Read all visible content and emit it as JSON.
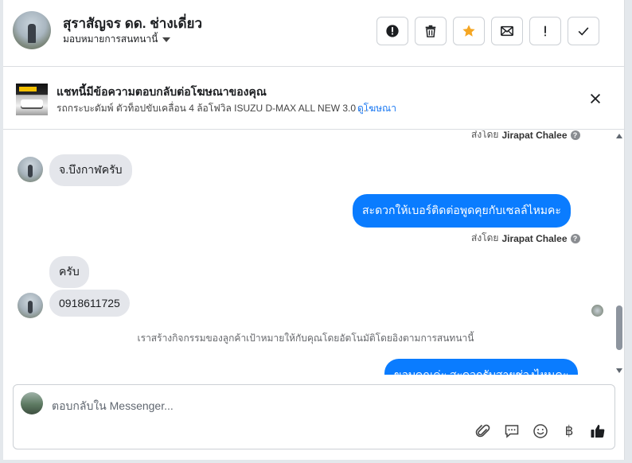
{
  "header": {
    "contact_name": "สุราสัญจร ดด. ช่างเดี่ยว",
    "assign_label": "มอบหมายการสนทนานี้",
    "actions": [
      "spam-icon",
      "trash-icon",
      "star-icon",
      "mail-icon",
      "exclamation-icon",
      "check-icon"
    ],
    "star_color": "#f5a623"
  },
  "ad": {
    "title": "แชทนี้มีข้อความตอบกลับต่อโฆษณาของคุณ",
    "description": "รถกระบะดัมพ์ ตัวท็อปขับเคลื่อน 4 ล้อโฟวิล ISUZU D-MAX ALL NEW 3.0 ...",
    "link": "ดูโฆษณา"
  },
  "chat": {
    "sent_by_prefix": "ส่งโดย",
    "sender_name": "Jirapat Chalee",
    "messages": [
      {
        "from": "customer",
        "text": "จ.บึงกาฬครับ"
      },
      {
        "from": "page",
        "text": "สะดวกให้เบอร์ติดต่อพูดคุยกับเซลล์ไหมคะ"
      },
      {
        "from": "customer",
        "text": "ครับ"
      },
      {
        "from": "customer",
        "text": "0918611725"
      },
      {
        "from": "page",
        "text": "ขอบคุณค่ะ สะดวกรับสายช่วงไหนคะ"
      }
    ],
    "system_note": "เราสร้างกิจกรรมของลูกค้าเป้าหมายให้กับคุณโดยอัตโนมัติโดยอิงตามการสนทนานี้",
    "outgoing_color": "#0a7cff"
  },
  "composer": {
    "placeholder": "ตอบกลับใน Messenger...",
    "icons": [
      "attachment-icon",
      "saved-reply-icon",
      "emoji-icon",
      "baht-icon",
      "like-icon"
    ],
    "baht_glyph": "฿"
  }
}
